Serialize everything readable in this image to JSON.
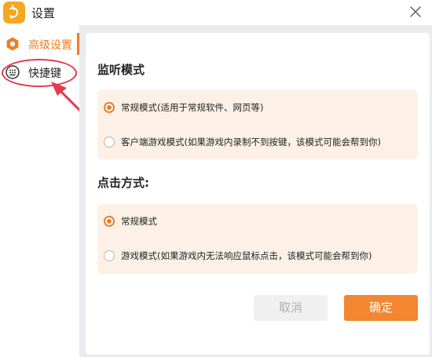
{
  "window": {
    "title": "设置",
    "icons": {
      "app": "app-logo-icon",
      "close": "close-icon"
    }
  },
  "sidebar": {
    "items": [
      {
        "label": "高级设置",
        "icon": "gear-icon",
        "active": true
      },
      {
        "label": "快捷键",
        "icon": "keyboard-icon",
        "active": false
      }
    ]
  },
  "listen_mode": {
    "title": "监听模式",
    "options": [
      {
        "label": "常规模式(适用于常规软件、网页等)",
        "selected": true
      },
      {
        "label": "客户端游戏模式(如果游戏内录制不到按键，该模式可能会帮到你)",
        "selected": false
      }
    ]
  },
  "click_mode": {
    "title": "点击方式:",
    "options": [
      {
        "label": "常规模式",
        "selected": true
      },
      {
        "label": "游戏模式(如果游戏内无法响应鼠标点击，该模式可能会帮到你)",
        "selected": false
      }
    ]
  },
  "buttons": {
    "cancel": "取消",
    "ok": "确定"
  },
  "colors": {
    "accent": "#ef7d22",
    "option_bg": "#fdf1e7",
    "content_bg": "#e9ebef",
    "annotation": "#e53950"
  }
}
